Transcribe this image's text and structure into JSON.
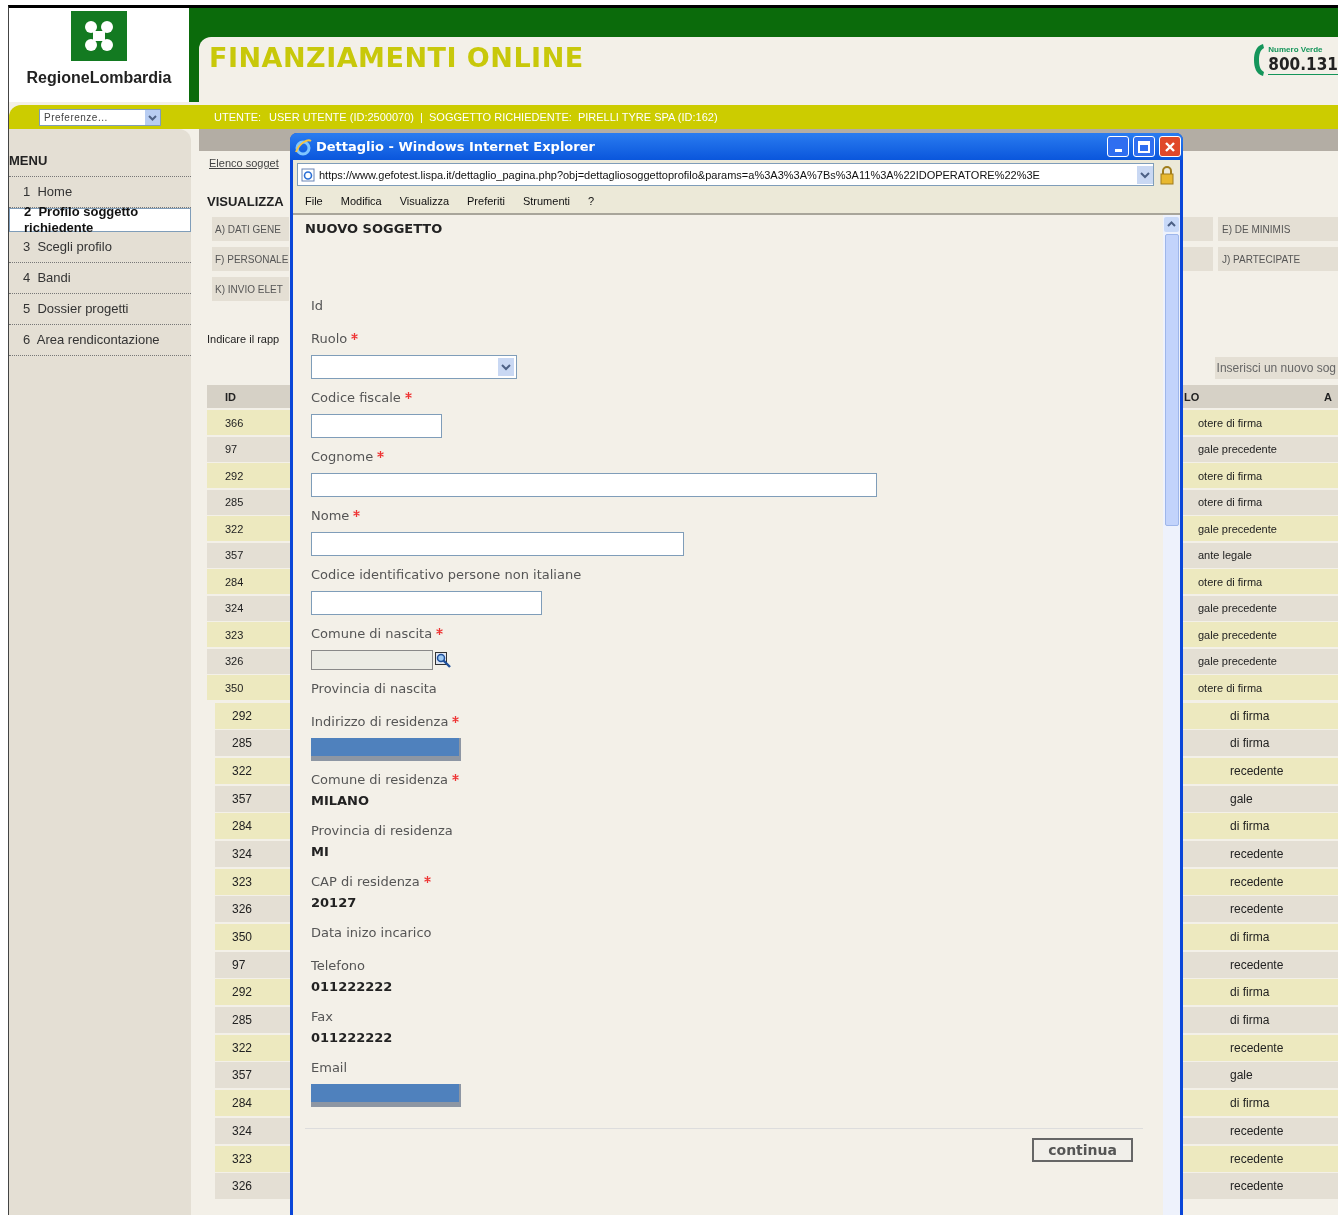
{
  "header": {
    "logo_text": "RegioneLombardia",
    "title": "FINANZIAMENTI ONLINE",
    "hotline_label": "Numero Verde",
    "hotline_number": "800.131"
  },
  "user_bar": {
    "preferences": "Preferenze...",
    "user_label": "UTENTE:",
    "user_text": "USER UTENTE (ID:2500070)  |  SOGGETTO RICHIEDENTE:  PIRELLI TYRE SPA (ID:162)"
  },
  "menu": {
    "title": "MENU",
    "items": [
      {
        "number": "1",
        "label": "Home",
        "selected": false
      },
      {
        "number": "2",
        "label": "Profilo soggetto richiedente",
        "selected": true
      },
      {
        "number": "3",
        "label": "Scegli profilo",
        "selected": false
      },
      {
        "number": "4",
        "label": "Bandi",
        "selected": false
      },
      {
        "number": "5",
        "label": "Dossier progetti",
        "selected": false
      },
      {
        "number": "6",
        "label": "Area rendicontazione",
        "selected": false
      }
    ]
  },
  "content": {
    "breadcrumb": "Elenco sogget",
    "heading": "VISUALIZZA",
    "tab_rows": [
      {
        "left": "A) DATI GENE",
        "right": "E) DE MINIMIS"
      },
      {
        "left": "F) PERSONALE",
        "right": "J) PARTECIPATE"
      },
      {
        "left": "K) INVIO ELET"
      }
    ],
    "instruction": "Indicare il rapp",
    "new_button": "Inserisci un nuovo sog"
  },
  "table": {
    "columns": [
      "ID",
      "LO",
      "A"
    ],
    "rows": [
      {
        "id": "366",
        "role": "otere di firma"
      },
      {
        "id": "97",
        "role": "gale precedente"
      },
      {
        "id": "292",
        "role": "otere di firma"
      },
      {
        "id": "285",
        "role": "otere di firma"
      },
      {
        "id": "322",
        "role": "gale precedente"
      },
      {
        "id": "357",
        "role": "ante legale"
      },
      {
        "id": "284",
        "role": "otere di firma"
      },
      {
        "id": "324",
        "role": "gale precedente"
      },
      {
        "id": "323",
        "role": "gale precedente"
      },
      {
        "id": "326",
        "role": "gale precedente"
      },
      {
        "id": "350",
        "role": "otere di firma"
      }
    ]
  },
  "table_continued": {
    "rows": [
      {
        "id": "292",
        "role": "di firma"
      },
      {
        "id": "285",
        "role": "di firma"
      },
      {
        "id": "322",
        "role": "recedente"
      },
      {
        "id": "357",
        "role": "gale"
      },
      {
        "id": "284",
        "role": "di firma"
      },
      {
        "id": "324",
        "role": "recedente"
      },
      {
        "id": "323",
        "role": "recedente"
      },
      {
        "id": "326",
        "role": "recedente"
      },
      {
        "id": "350",
        "role": "di firma"
      },
      {
        "id": "97",
        "role": "recedente"
      },
      {
        "id": "292",
        "role": "di firma"
      },
      {
        "id": "285",
        "role": "di firma"
      },
      {
        "id": "322",
        "role": "recedente"
      },
      {
        "id": "357",
        "role": "gale"
      },
      {
        "id": "284",
        "role": "di firma"
      },
      {
        "id": "324",
        "role": "recedente"
      },
      {
        "id": "323",
        "role": "recedente"
      },
      {
        "id": "326",
        "role": "recedente"
      }
    ]
  },
  "popup": {
    "title": "Dettaglio - Windows Internet Explorer",
    "url": "https://www.gefotest.lispa.it/dettaglio_pagina.php?obj=dettagliosoggettoprofilo&params=a%3A3%3A%7Bs%3A11%3A%22IDOPERATORE%22%3E",
    "menu": [
      "File",
      "Modifica",
      "Visualizza",
      "Preferiti",
      "Strumenti",
      "?"
    ],
    "heading": "NUOVO SOGGETTO",
    "fields": [
      {
        "label": "Id",
        "kind": "label",
        "required": false
      },
      {
        "label": "Ruolo",
        "kind": "select",
        "required": true
      },
      {
        "label": "Codice fiscale",
        "kind": "input",
        "required": true
      },
      {
        "label": "Cognome",
        "kind": "input",
        "required": true
      },
      {
        "label": "Nome",
        "kind": "input",
        "required": true
      },
      {
        "label": "Codice identificativo persone non italiane",
        "kind": "input",
        "required": false
      },
      {
        "label": "Comune di nascita",
        "kind": "lookup",
        "required": true
      },
      {
        "label": "Provincia di nascita",
        "kind": "label",
        "required": false
      },
      {
        "label": "Indirizzo di residenza",
        "kind": "masked",
        "required": true
      },
      {
        "label": "Comune di residenza",
        "kind": "value",
        "required": true,
        "value": "MILANO"
      },
      {
        "label": "Provincia di residenza",
        "kind": "value",
        "required": false,
        "value": "MI"
      },
      {
        "label": "CAP di residenza",
        "kind": "value",
        "required": true,
        "value": "20127"
      },
      {
        "label": "Data inizo incarico",
        "kind": "label",
        "required": false
      },
      {
        "label": "Telefono",
        "kind": "value",
        "required": false,
        "value": "011222222"
      },
      {
        "label": "Fax",
        "kind": "value",
        "required": false,
        "value": "011222222"
      },
      {
        "label": "Email",
        "kind": "masked",
        "required": false
      }
    ],
    "button": "continua"
  }
}
